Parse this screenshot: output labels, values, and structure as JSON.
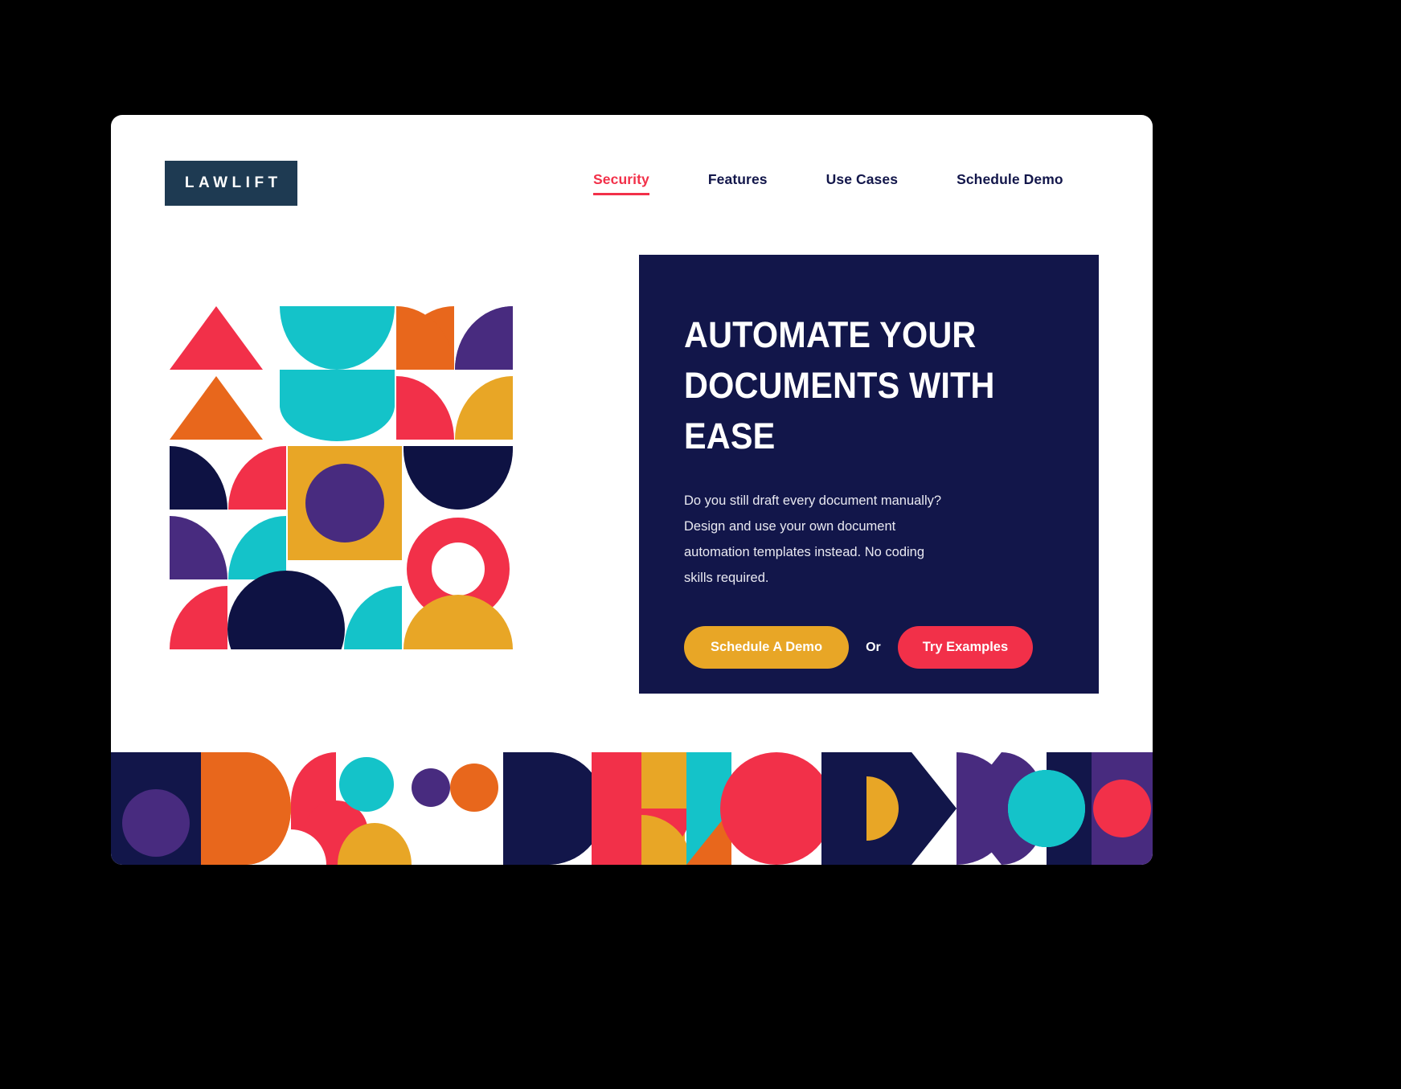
{
  "brand": {
    "logo_text": "LAWLIFT",
    "logo_bg": "#1e3a52"
  },
  "nav": {
    "items": [
      {
        "label": "Security",
        "active": true
      },
      {
        "label": "Features",
        "active": false
      },
      {
        "label": "Use Cases",
        "active": false
      },
      {
        "label": "Schedule Demo",
        "active": false
      }
    ]
  },
  "hero": {
    "title_line1": "AUTOMATE YOUR",
    "title_line2": "DOCUMENTS WITH EASE",
    "paragraph": "Do you still draft every document manually? Design and use your own document automation templates instead. No coding skills required.",
    "primary_cta": "Schedule A Demo",
    "divider_text": "Or",
    "secondary_cta": "Try Examples",
    "panel_bg": "#12164a"
  },
  "palette": {
    "navy": "#12164a",
    "deep_navy": "#0e1243",
    "red": "#f23049",
    "orange": "#e8671c",
    "amber": "#e8a626",
    "teal": "#14c3c9",
    "purple": "#482b7f",
    "white": "#ffffff",
    "accent_red": "#f23049"
  },
  "artwork": {
    "hero_pattern_name": "geometric-bauhaus-grid",
    "footer_pattern_name": "geometric-bauhaus-strip"
  }
}
